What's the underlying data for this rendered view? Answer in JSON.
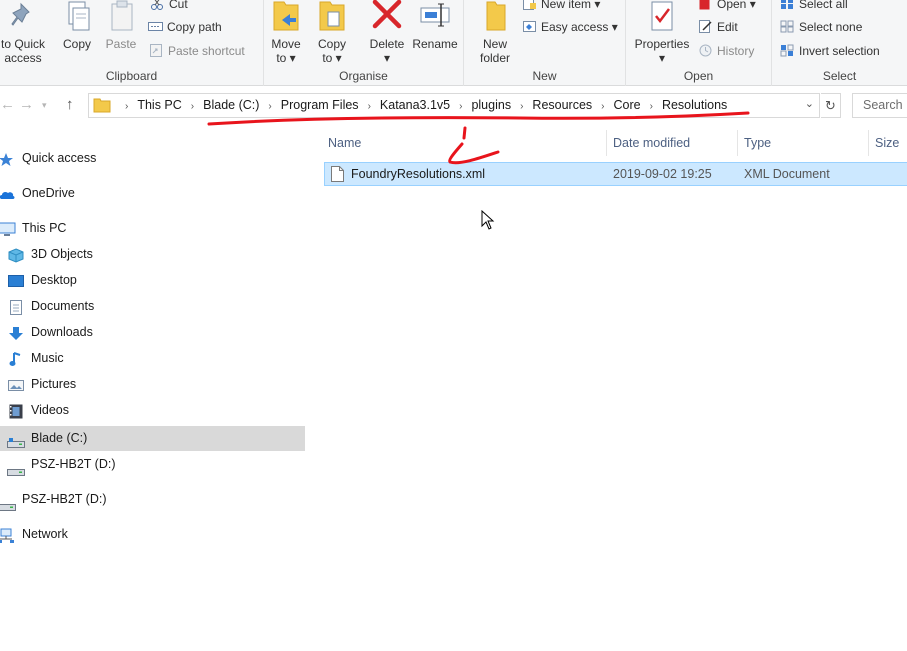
{
  "ribbon": {
    "clipboard": {
      "label": "Clipboard",
      "pin_label_1": "to Quick",
      "pin_label_2": "access",
      "copy_label": "Copy",
      "paste_label": "Paste",
      "cut_label": "Cut",
      "copy_path_label": "Copy path",
      "paste_shortcut_label": "Paste shortcut"
    },
    "organise": {
      "label": "Organise",
      "move_to_1": "Move",
      "move_to_2": "to ▾",
      "copy_to_1": "Copy",
      "copy_to_2": "to ▾",
      "delete_1": "Delete",
      "delete_2": "▾",
      "rename_label": "Rename"
    },
    "new": {
      "label": "New",
      "new_folder_1": "New",
      "new_folder_2": "folder",
      "new_item_label": "New item ▾",
      "easy_access_label": "Easy access ▾"
    },
    "open": {
      "label": "Open",
      "properties_1": "Properties",
      "properties_2": "▾",
      "open_label": "Open ▾",
      "edit_label": "Edit",
      "history_label": "History"
    },
    "select": {
      "label": "Select",
      "select_all_label": "Select all",
      "select_none_label": "Select none",
      "invert_label": "Invert selection"
    }
  },
  "address": {
    "crumbs": [
      "This PC",
      "Blade (C:)",
      "Program Files",
      "Katana3.1v5",
      "plugins",
      "Resources",
      "Core",
      "Resolutions"
    ],
    "search_placeholder": "Search R"
  },
  "navpane": {
    "items": [
      {
        "label": "Quick access",
        "icon": "star-icon"
      },
      {
        "label": "OneDrive",
        "icon": "cloud-icon"
      },
      {
        "label": "This PC",
        "icon": "monitor-icon"
      },
      {
        "label": "3D Objects",
        "icon": "cube-icon"
      },
      {
        "label": "Desktop",
        "icon": "desktop-icon"
      },
      {
        "label": "Documents",
        "icon": "document-icon"
      },
      {
        "label": "Downloads",
        "icon": "download-arrow-icon"
      },
      {
        "label": "Music",
        "icon": "music-note-icon"
      },
      {
        "label": "Pictures",
        "icon": "picture-icon"
      },
      {
        "label": "Videos",
        "icon": "film-icon"
      },
      {
        "label": "Blade (C:)",
        "icon": "drive-icon"
      },
      {
        "label": "PSZ-HB2T (D:)",
        "icon": "drive-icon"
      },
      {
        "label": "PSZ-HB2T (D:)",
        "icon": "drive-icon"
      },
      {
        "label": "Network",
        "icon": "network-icon"
      }
    ],
    "selected": "Blade (C:)"
  },
  "filelist": {
    "columns": [
      "Name",
      "Date modified",
      "Type",
      "Size"
    ],
    "rows": [
      {
        "name": "FoundryResolutions.xml",
        "date": "2019-09-02 19:25",
        "type": "XML Document",
        "size": ""
      }
    ]
  },
  "colors": {
    "ribbon_bg": "#f5f6f7",
    "selection": "#cce8ff",
    "selection_border": "#99d1ff",
    "nav_selected": "#d9d9d9",
    "annotation_red": "#e8141c",
    "column_header": "#4d6082"
  }
}
